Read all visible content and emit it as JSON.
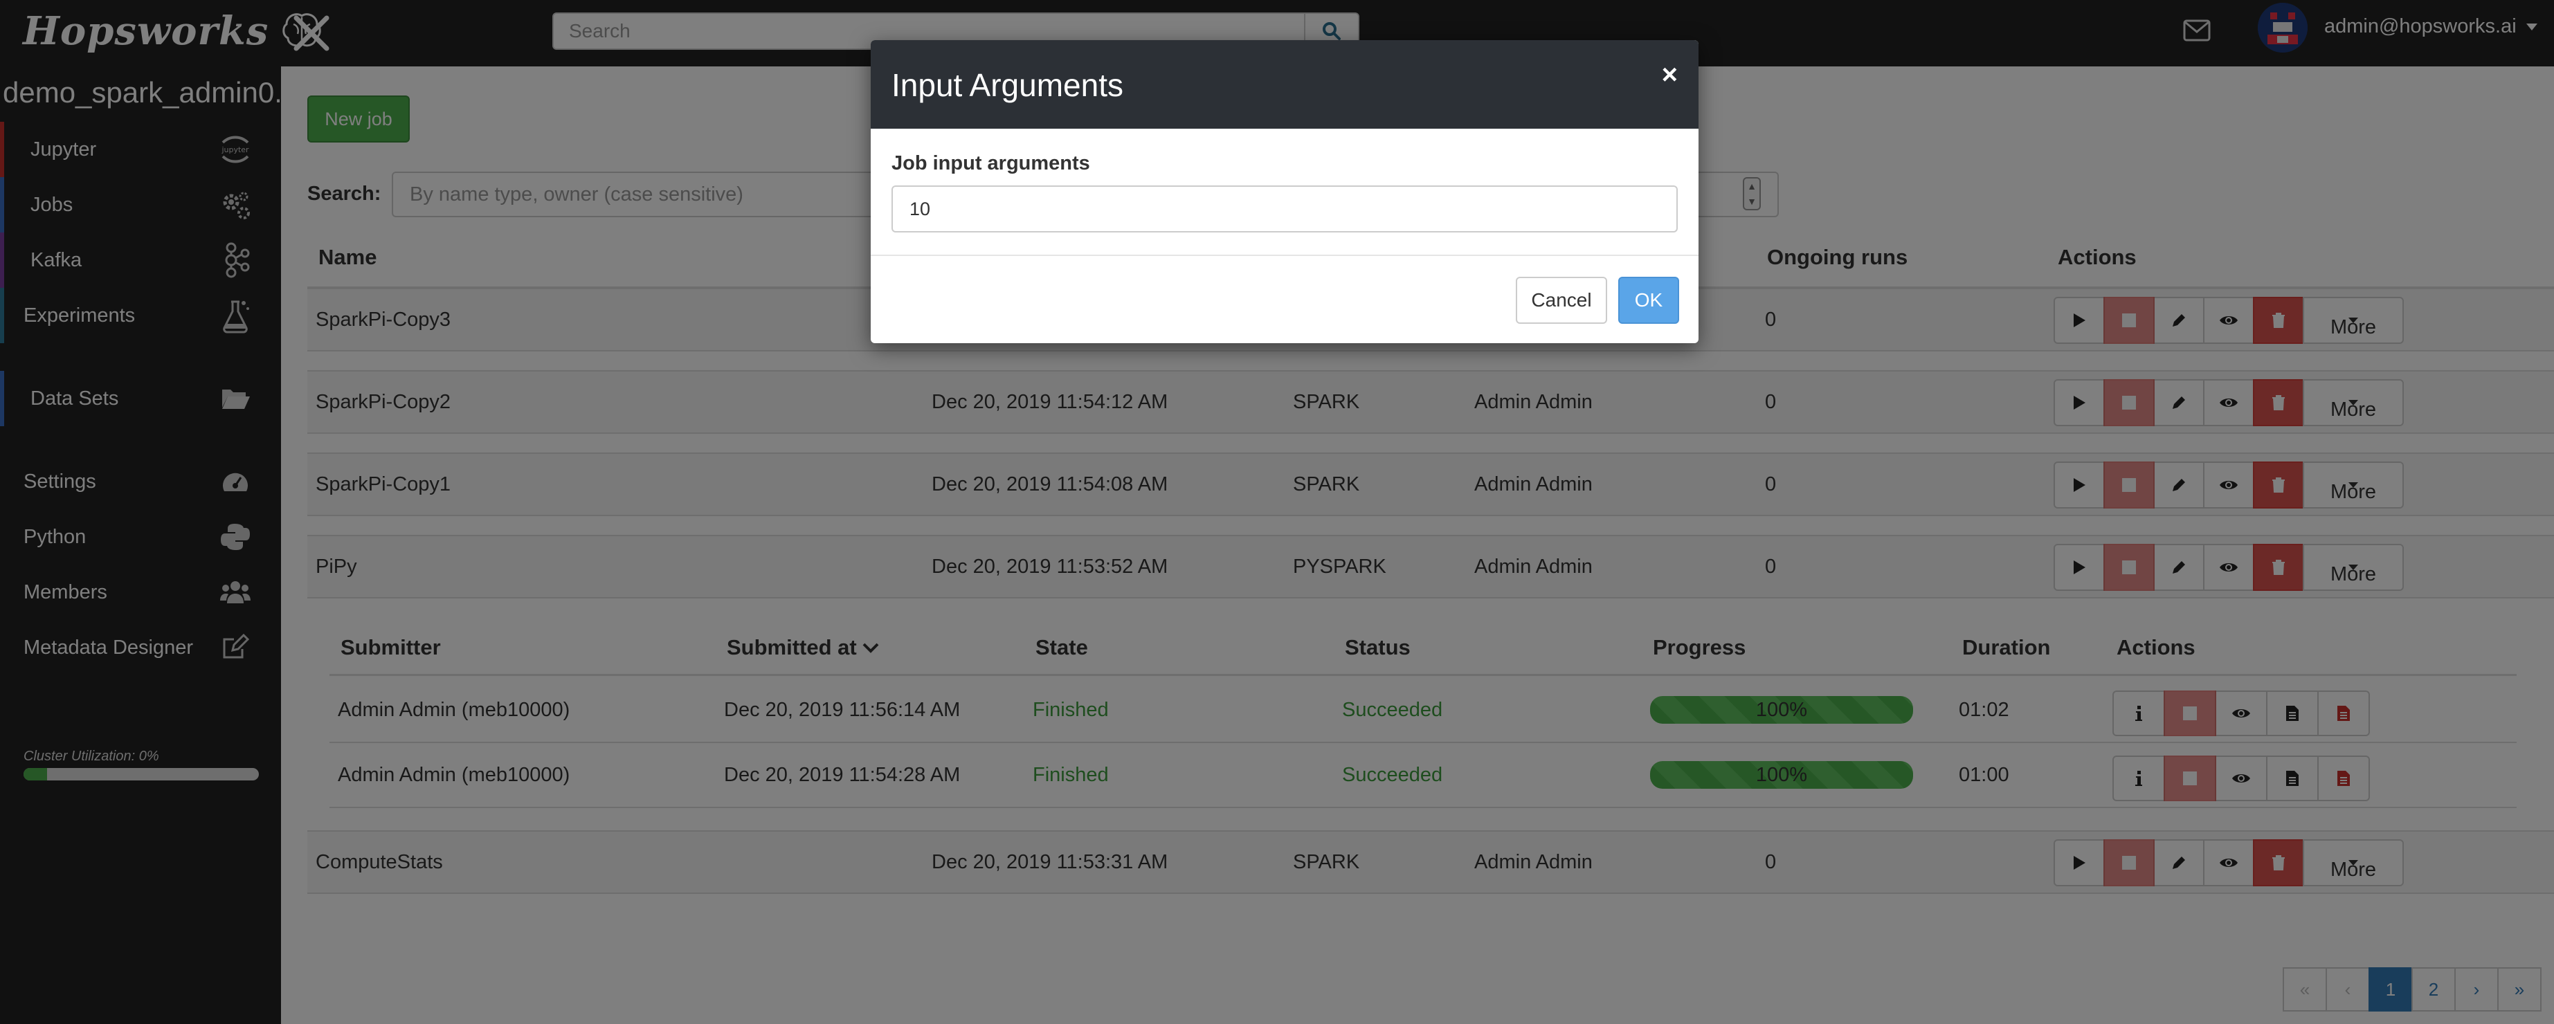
{
  "topbar": {
    "logo_text": "Hopsworks",
    "search_placeholder": "Search",
    "user": "admin@hopsworks.ai"
  },
  "sidebar": {
    "project": "demo_spark_admin0...",
    "items": [
      {
        "label": "Jupyter",
        "icon": "jupyter-icon",
        "accent": "#c9302c"
      },
      {
        "label": "Jobs",
        "icon": "gears-icon",
        "accent": "#3b6fc4"
      },
      {
        "label": "Kafka",
        "icon": "kafka-icon",
        "accent": "#7a3fa0"
      },
      {
        "label": "Experiments",
        "icon": "flask-icon",
        "accent": "#2f7d9c"
      },
      {
        "label": "Data Sets",
        "icon": "folder-open-icon",
        "accent": "#3b6fc4"
      },
      {
        "label": "Settings",
        "icon": "dashboard-icon",
        "accent": ""
      },
      {
        "label": "Python",
        "icon": "python-icon",
        "accent": ""
      },
      {
        "label": "Members",
        "icon": "users-icon",
        "accent": ""
      },
      {
        "label": "Metadata Designer",
        "icon": "edit-icon",
        "accent": ""
      }
    ],
    "cluster_label": "Cluster Utilization: 0%",
    "cluster_utilization": 0.1
  },
  "content": {
    "new_job": "New job",
    "search_label": "Search:",
    "search_placeholder": "By name type, owner (case sensitive)",
    "headers": {
      "name": "Name",
      "ongoing": "Ongoing runs",
      "actions": "Actions"
    },
    "more_label": "More",
    "jobs": [
      {
        "name": "SparkPi-Copy3",
        "date": "",
        "type": "",
        "owner": "",
        "ongoing": "0"
      },
      {
        "name": "SparkPi-Copy2",
        "date": "Dec 20, 2019 11:54:12 AM",
        "type": "SPARK",
        "owner": "Admin Admin",
        "ongoing": "0"
      },
      {
        "name": "SparkPi-Copy1",
        "date": "Dec 20, 2019 11:54:08 AM",
        "type": "SPARK",
        "owner": "Admin Admin",
        "ongoing": "0"
      },
      {
        "name": "PiPy",
        "date": "Dec 20, 2019 11:53:52 AM",
        "type": "PYSPARK",
        "owner": "Admin Admin",
        "ongoing": "0"
      },
      {
        "name": "ComputeStats",
        "date": "Dec 20, 2019 11:53:31 AM",
        "type": "SPARK",
        "owner": "Admin Admin",
        "ongoing": "0"
      }
    ],
    "exec_headers": {
      "submitter": "Submitter",
      "submitted_at": "Submitted at",
      "state": "State",
      "status": "Status",
      "progress": "Progress",
      "duration": "Duration",
      "actions": "Actions"
    },
    "executions": [
      {
        "submitter": "Admin Admin (meb10000)",
        "submitted_at": "Dec 20, 2019 11:56:14 AM",
        "state": "Finished",
        "status": "Succeeded",
        "progress": "100%",
        "duration": "01:02"
      },
      {
        "submitter": "Admin Admin (meb10000)",
        "submitted_at": "Dec 20, 2019 11:54:28 AM",
        "state": "Finished",
        "status": "Succeeded",
        "progress": "100%",
        "duration": "01:00"
      }
    ],
    "pagination": [
      "«",
      "‹",
      "1",
      "2",
      "›",
      "»"
    ]
  },
  "modal": {
    "title": "Input Arguments",
    "close": "×",
    "label": "Job input arguments",
    "value": "10",
    "cancel": "Cancel",
    "ok": "OK"
  }
}
